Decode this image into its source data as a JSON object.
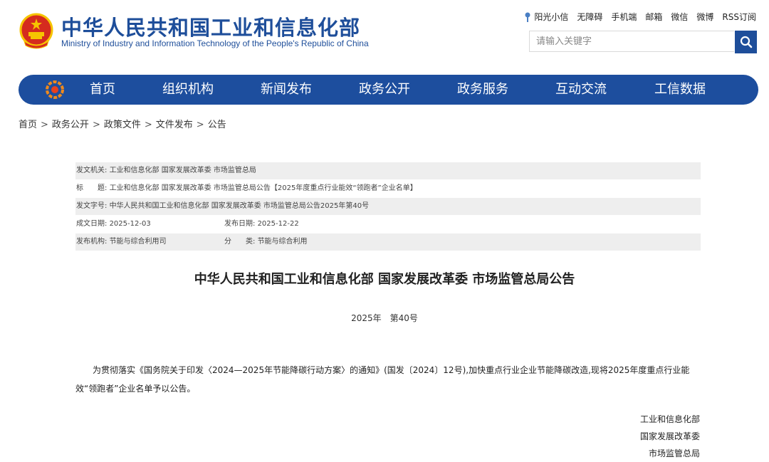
{
  "header": {
    "title": "中华人民共和国工业和信息化部",
    "subtitle": "Ministry of Industry and Information Technology of the People's Republic of China"
  },
  "top_links": [
    "阳光小信",
    "无障碍",
    "手机端",
    "邮箱",
    "微信",
    "微博",
    "RSS订阅"
  ],
  "search": {
    "placeholder": "请输入关键字"
  },
  "nav": [
    "首页",
    "组织机构",
    "新闻发布",
    "政务公开",
    "政务服务",
    "互动交流",
    "工信数据"
  ],
  "breadcrumb": [
    "首页",
    "政务公开",
    "政策文件",
    "文件发布",
    "公告"
  ],
  "meta": {
    "issuer_label": "发文机关:",
    "issuer": "工业和信息化部 国家发展改革委 市场监管总局",
    "title_label": "标　　题:",
    "title": "工业和信息化部 国家发展改革委 市场监管总局公告【2025年度重点行业能效“领跑者”企业名单】",
    "doc_no_label": "发文字号:",
    "doc_no": "中华人民共和国工业和信息化部 国家发展改革委 市场监管总局公告2025年第40号",
    "created_label": "成文日期:",
    "created": "2025-12-03",
    "published_label": "发布日期:",
    "published": "2025-12-22",
    "org_label": "发布机构:",
    "org": "节能与综合利用司",
    "category_label": "分　　类:",
    "category": "节能与综合利用"
  },
  "document": {
    "heading": "中华人民共和国工业和信息化部 国家发展改革委 市场监管总局公告",
    "number": "2025年　第40号",
    "paragraph": "为贯彻落实《国务院关于印发〈2024—2025年节能降碳行动方案〉的通知》(国发〔2024〕12号),加快重点行业企业节能降碳改造,现将2025年度重点行业能效“领跑者”企业名单予以公告。",
    "signatures": [
      "工业和信息化部",
      "国家发展改革委",
      "市场监管总局"
    ]
  },
  "colors": {
    "brand_blue": "#1d4e9e",
    "emblem_red": "#d52b1e",
    "emblem_gold": "#f6c400"
  },
  "icons": {
    "search": "search-icon",
    "sun": "sunshine-icon",
    "emblem": "national-emblem-icon",
    "logo": "miit-logo-icon"
  }
}
